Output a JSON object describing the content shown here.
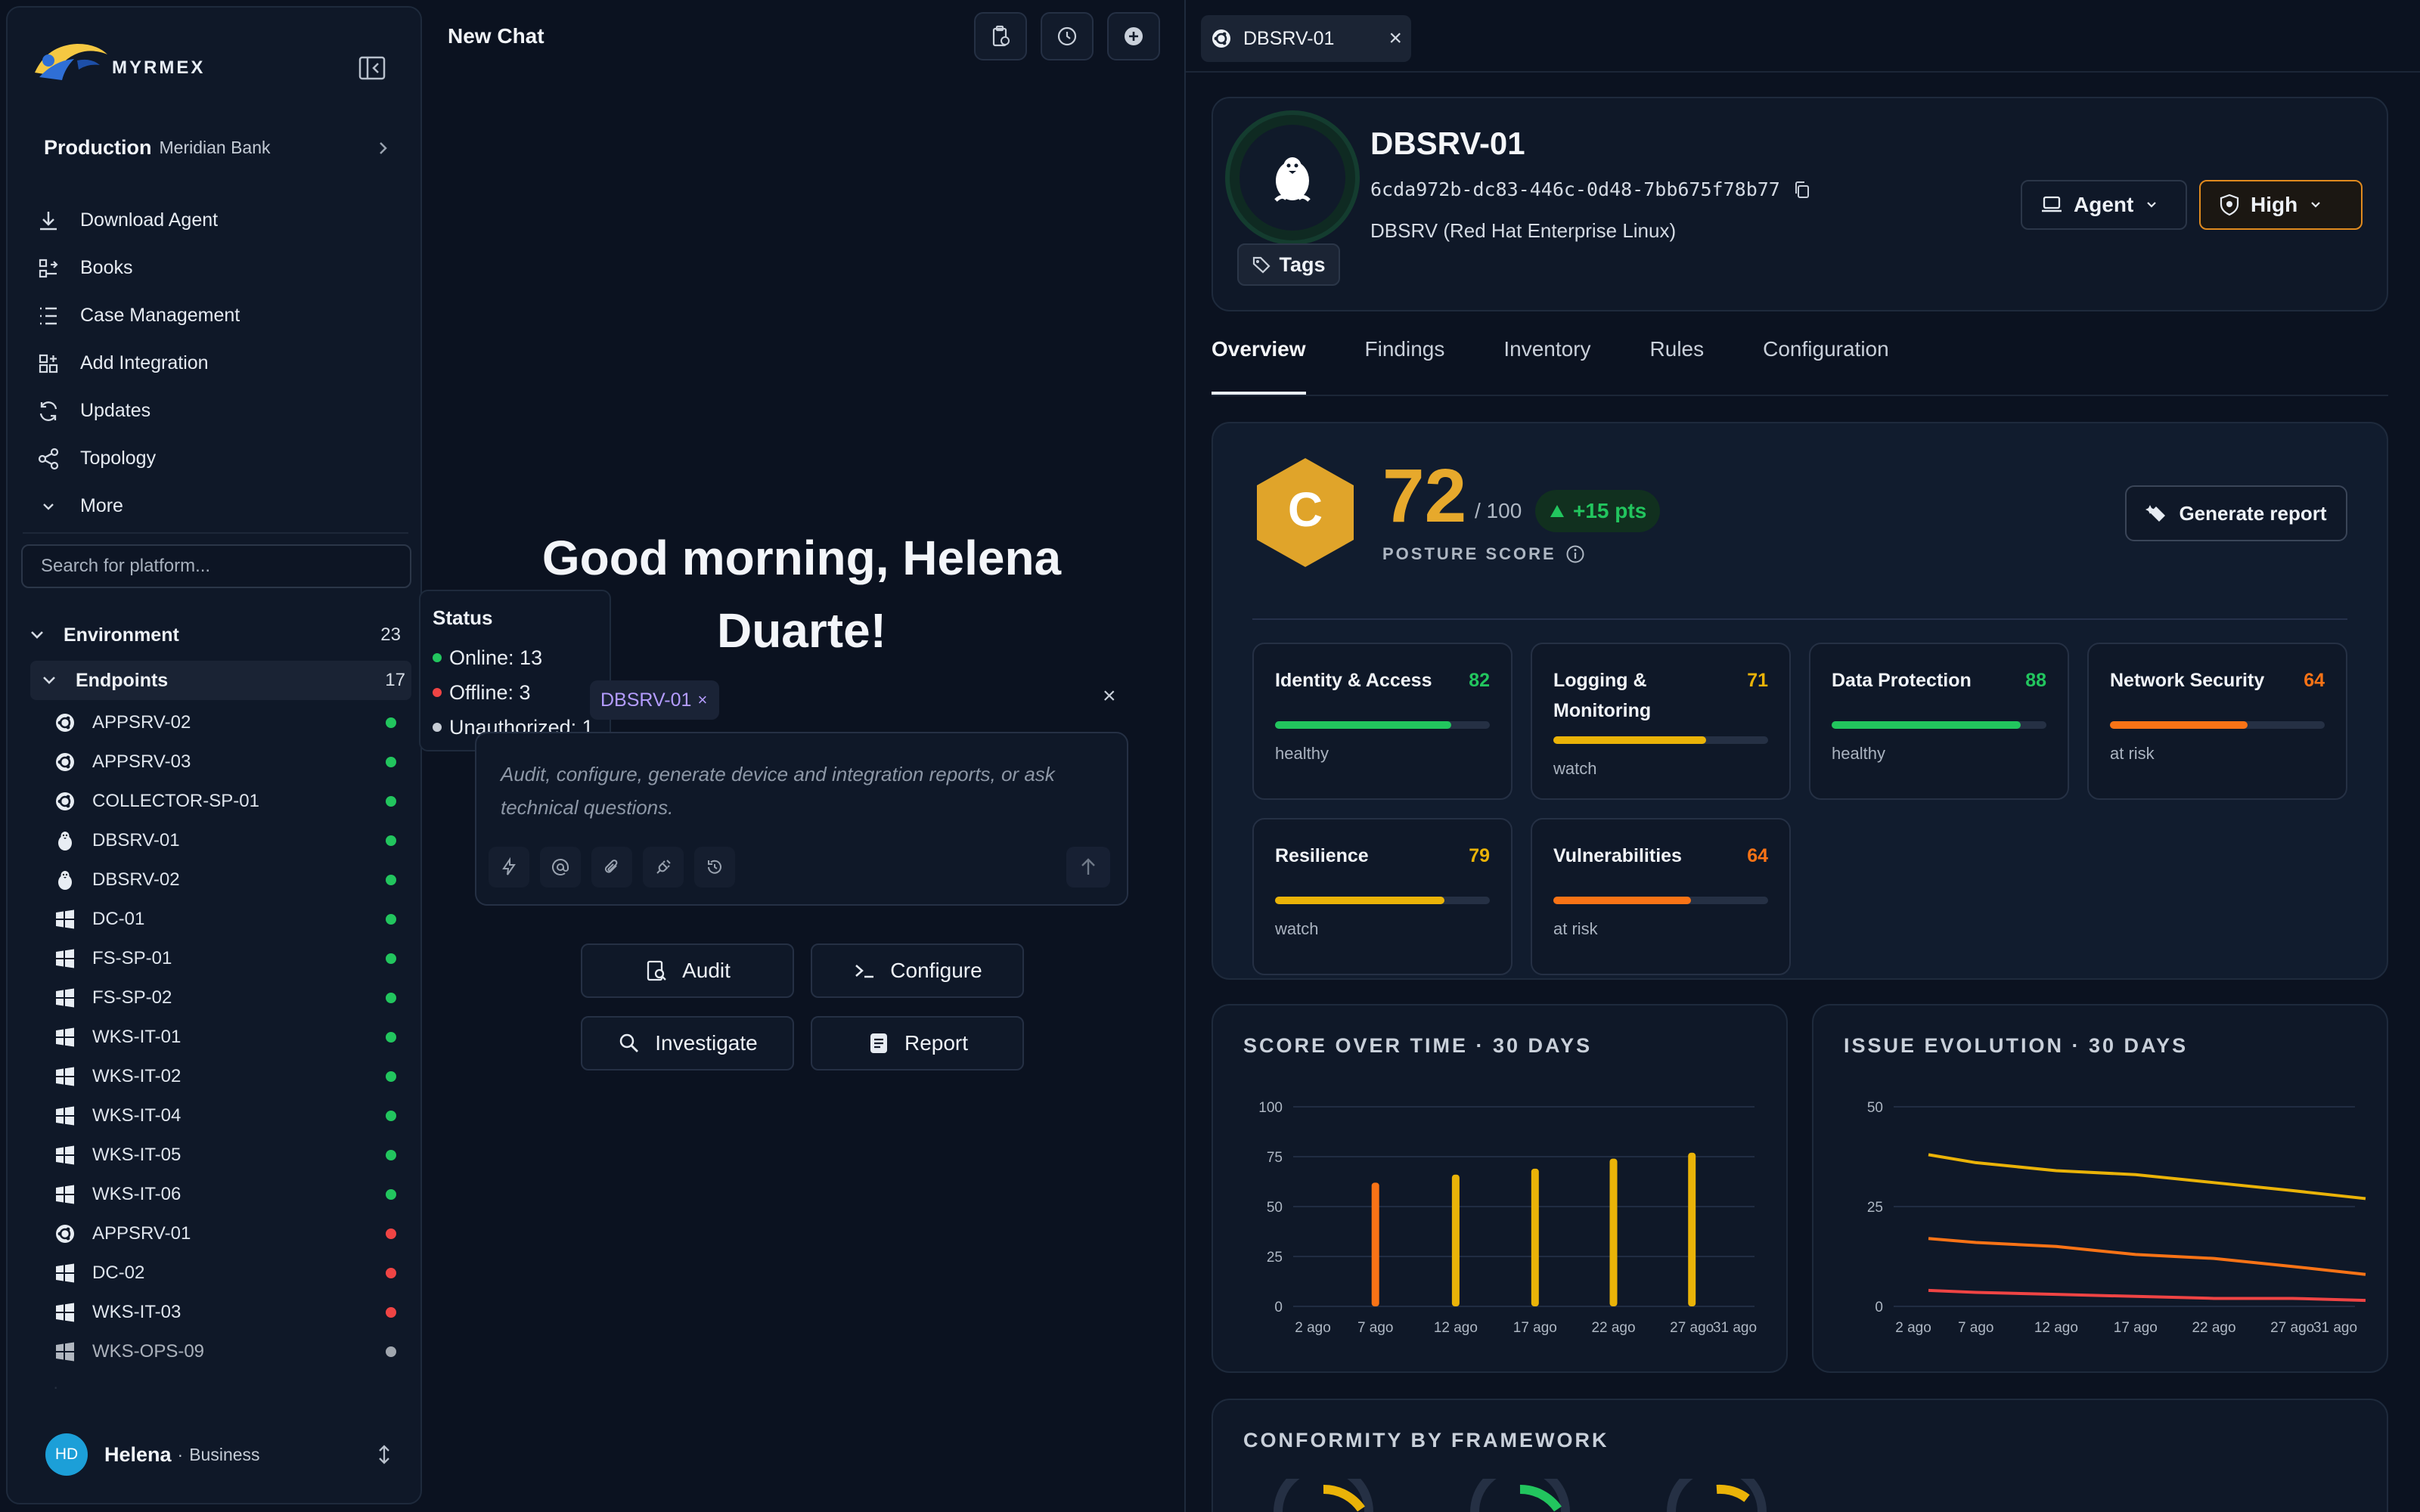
{
  "app": {
    "logo_text": "MYRMEX"
  },
  "workspace": {
    "name": "Production",
    "org": "Meridian Bank"
  },
  "nav": [
    {
      "label": "Download Agent",
      "icon": "download-icon"
    },
    {
      "label": "Books",
      "icon": "books-icon"
    },
    {
      "label": "Case Management",
      "icon": "list-icon"
    },
    {
      "label": "Add Integration",
      "icon": "integration-icon"
    },
    {
      "label": "Updates",
      "icon": "refresh-icon"
    },
    {
      "label": "Topology",
      "icon": "share-icon"
    },
    {
      "label": "More",
      "icon": "chevron-down-icon"
    }
  ],
  "search": {
    "placeholder": "Search for platform..."
  },
  "environment": {
    "label": "Environment",
    "count": "23"
  },
  "endpoints": {
    "label": "Endpoints",
    "count": "17",
    "items": [
      {
        "name": "APPSRV-02",
        "os": "ubuntu",
        "status": "online"
      },
      {
        "name": "APPSRV-03",
        "os": "ubuntu",
        "status": "online"
      },
      {
        "name": "COLLECTOR-SP-01",
        "os": "ubuntu",
        "status": "online"
      },
      {
        "name": "DBSRV-01",
        "os": "linux",
        "status": "online"
      },
      {
        "name": "DBSRV-02",
        "os": "linux",
        "status": "online"
      },
      {
        "name": "DC-01",
        "os": "windows",
        "status": "online"
      },
      {
        "name": "FS-SP-01",
        "os": "windows",
        "status": "online"
      },
      {
        "name": "FS-SP-02",
        "os": "windows",
        "status": "online"
      },
      {
        "name": "WKS-IT-01",
        "os": "windows",
        "status": "online"
      },
      {
        "name": "WKS-IT-02",
        "os": "windows",
        "status": "online"
      },
      {
        "name": "WKS-IT-04",
        "os": "windows",
        "status": "online"
      },
      {
        "name": "WKS-IT-05",
        "os": "windows",
        "status": "online"
      },
      {
        "name": "WKS-IT-06",
        "os": "windows",
        "status": "online"
      },
      {
        "name": "APPSRV-01",
        "os": "ubuntu",
        "status": "offline"
      },
      {
        "name": "DC-02",
        "os": "windows",
        "status": "offline"
      },
      {
        "name": "WKS-IT-03",
        "os": "windows",
        "status": "offline"
      },
      {
        "name": "WKS-OPS-09",
        "os": "windows",
        "status": "unauthorized"
      }
    ]
  },
  "status_colors": {
    "online": "#22c55e",
    "offline": "#ef4444",
    "unauthorized": "#d1d5db"
  },
  "user": {
    "initials": "HD",
    "name": "Helena",
    "plan": "Business"
  },
  "tooltip": {
    "title": "Status",
    "online": "Online: 13",
    "offline": "Offline: 3",
    "unauthorized": "Unauthorized: 1"
  },
  "chat": {
    "title": "New Chat",
    "greeting": "Good morning, Helena Duarte!",
    "chip": "DBSRV-01",
    "placeholder": "Audit, configure, generate device and integration reports, or ask technical questions.",
    "actions": [
      "Audit",
      "Configure",
      "Investigate",
      "Report"
    ]
  },
  "device": {
    "tab": "DBSRV-01",
    "name": "DBSRV-01",
    "id": "6cda972b-dc83-446c-0d48-7bb675f78b77",
    "desc": "DBSRV (Red Hat Enterprise Linux)",
    "tags_label": "Tags",
    "agent_label": "Agent",
    "severity_label": "High",
    "tabs": [
      "Overview",
      "Findings",
      "Inventory",
      "Rules",
      "Configuration"
    ]
  },
  "posture": {
    "grade": "C",
    "score": "72",
    "max": "/ 100",
    "delta": "+15 pts",
    "label": "POSTURE SCORE",
    "report_button": "Generate report",
    "categories": [
      {
        "name": "Identity & Access",
        "value": 82,
        "status": "healthy"
      },
      {
        "name": "Logging & Monitoring",
        "value": 71,
        "status": "watch"
      },
      {
        "name": "Data Protection",
        "value": 88,
        "status": "healthy"
      },
      {
        "name": "Network Security",
        "value": 64,
        "status": "at risk"
      },
      {
        "name": "Resilience",
        "value": 79,
        "status": "watch"
      },
      {
        "name": "Vulnerabilities",
        "value": 64,
        "status": "at risk"
      }
    ],
    "status_colors": {
      "healthy": "#22c55e",
      "watch": "#eab308",
      "at risk": "#f97316"
    }
  },
  "chart_data": [
    {
      "type": "bar",
      "title": "SCORE OVER TIME · 30 DAYS",
      "categories": [
        "2 ago",
        "7 ago",
        "12 ago",
        "17 ago",
        "22 ago",
        "27 ago",
        "31 ago"
      ],
      "values": [
        null,
        62,
        66,
        69,
        74,
        77,
        null
      ],
      "colors": [
        null,
        "#f97316",
        "#eab308",
        "#eab308",
        "#eab308",
        "#eab308",
        null
      ],
      "ylim": [
        0,
        100
      ],
      "yticks": [
        0,
        25,
        50,
        75,
        100
      ],
      "grid": true
    },
    {
      "type": "line",
      "title": "ISSUE EVOLUTION · 30 DAYS",
      "categories": [
        "2 ago",
        "7 ago",
        "12 ago",
        "17 ago",
        "22 ago",
        "27 ago",
        "31 ago"
      ],
      "series": [
        {
          "color": "#eab308",
          "values": [
            38,
            36,
            34,
            33,
            31,
            29,
            27
          ]
        },
        {
          "color": "#f97316",
          "values": [
            17,
            16,
            15,
            13,
            12,
            10,
            8
          ]
        },
        {
          "color": "#ef4444",
          "values": [
            4,
            3.5,
            3,
            2.5,
            2,
            2,
            1.5
          ]
        }
      ],
      "ylim": [
        0,
        50
      ],
      "yticks": [
        0,
        25,
        50
      ],
      "grid": true
    }
  ],
  "conformity": {
    "title": "CONFORMITY BY FRAMEWORK"
  }
}
